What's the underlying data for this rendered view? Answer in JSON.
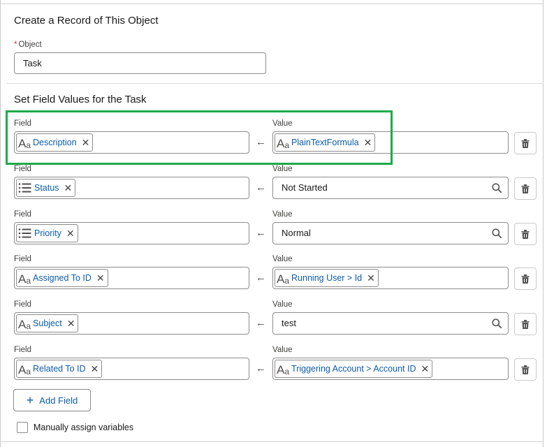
{
  "create_section": {
    "title": "Create a Record of This Object",
    "object_label": "Object",
    "required_mark": "*",
    "object_value": "Task"
  },
  "set_fields_section": {
    "title": "Set Field Values for the Task",
    "field_label": "Field",
    "value_label": "Value",
    "rows": [
      {
        "field": "Description",
        "field_icon": "text-icon",
        "value": "PlainTextFormula",
        "value_type": "pill",
        "value_icon": "text-icon"
      },
      {
        "field": "Status",
        "field_icon": "picklist-icon",
        "value": "Not Started",
        "value_type": "lookup"
      },
      {
        "field": "Priority",
        "field_icon": "picklist-icon",
        "value": "Normal",
        "value_type": "lookup"
      },
      {
        "field": "Assigned To ID",
        "field_icon": "text-icon",
        "value": "Running User > Id",
        "value_type": "pill",
        "value_icon": "text-icon"
      },
      {
        "field": "Subject",
        "field_icon": "text-icon",
        "value": "test",
        "value_type": "lookup"
      },
      {
        "field": "Related To ID",
        "field_icon": "text-icon",
        "value": "Triggering Account > Account ID",
        "value_type": "pill",
        "value_icon": "text-icon"
      }
    ],
    "arrow_glyph": "←",
    "remove_glyph": "✕",
    "add_field_label": "Add Field"
  },
  "manual_assign": {
    "label": "Manually assign variables",
    "checked": false
  },
  "colors": {
    "accent_link": "#0b5cab",
    "highlight_box": "#1eab4a",
    "required": "#c23934"
  }
}
